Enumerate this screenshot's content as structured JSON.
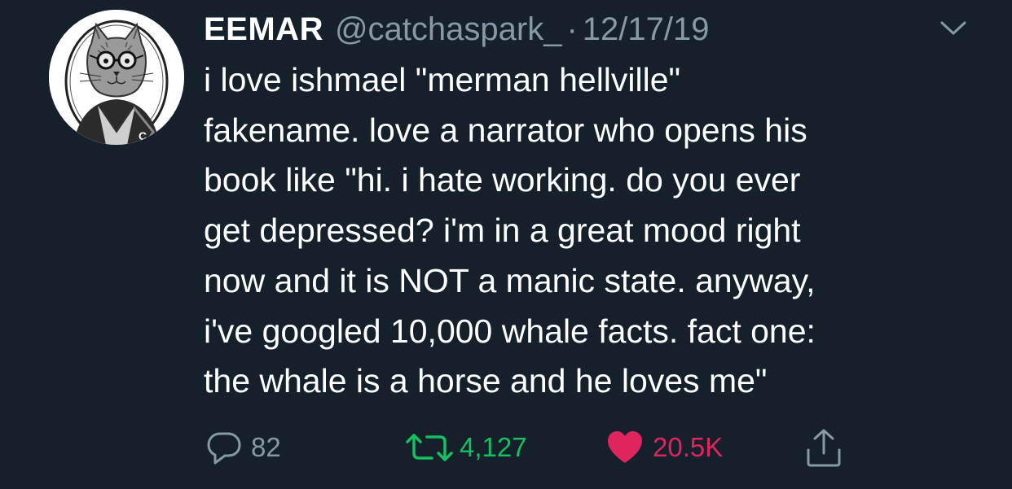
{
  "tweet": {
    "author": {
      "display_name": "EEMAR",
      "handle": "@catchaspark_",
      "separator": "·",
      "timestamp": "12/17/19"
    },
    "text": "i love ishmael \"merman hellville\"\nfakename. love a narrator who opens his\nbook like \"hi. i hate working. do you ever\nget depressed? i'm in a great mood right\nnow and it is NOT a manic state. anyway,\ni've googled 10,000 whale facts. fact one:\nthe whale is a horse and he loves me\"",
    "stats": {
      "replies": "82",
      "retweets": "4,127",
      "likes": "20.5K"
    }
  },
  "icons": {
    "avatar": "cat-with-glasses-avatar",
    "menu": "chevron-down-icon",
    "reply": "reply-bubble-icon",
    "retweet": "retweet-icon",
    "like": "heart-icon",
    "share": "share-icon"
  },
  "colors": {
    "background": "#15202b",
    "text_primary": "#ffffff",
    "text_secondary": "#8899a6",
    "retweet_green": "#17bf63",
    "like_red": "#e0245e"
  }
}
